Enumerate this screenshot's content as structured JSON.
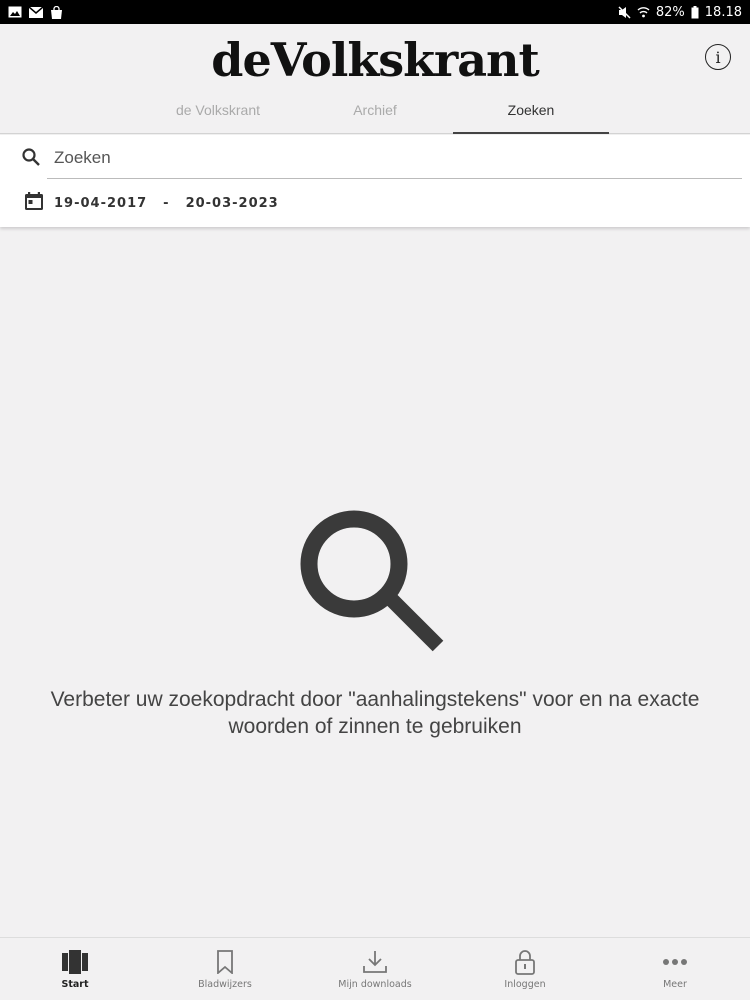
{
  "status_bar": {
    "battery": "82%",
    "time": "18.18",
    "left_icons": [
      "image-icon",
      "mail-icon",
      "shopping-bag-icon"
    ],
    "right_icons": [
      "mute-icon",
      "wifi-icon",
      "battery-icon"
    ]
  },
  "header": {
    "logo": "deVolkskrant",
    "info_icon": "info-icon"
  },
  "tabs": [
    {
      "label": "de Volkskrant"
    },
    {
      "label": "Archief"
    },
    {
      "label": "Zoeken"
    }
  ],
  "search": {
    "placeholder": "Zoeken",
    "value": "",
    "date_from": "19-04-2017",
    "date_separator": "-",
    "date_to": "20-03-2023",
    "icons": [
      "search-icon",
      "calendar-icon"
    ]
  },
  "empty_state": {
    "icon": "magnifier-icon",
    "message": "Verbeter uw zoekopdracht door \"aanhalingstekens\" voor en na exacte woorden of zinnen te gebruiken"
  },
  "bottom_nav": [
    {
      "label": "Start",
      "icon": "newspaper-icon",
      "active": true
    },
    {
      "label": "Bladwijzers",
      "icon": "bookmark-icon",
      "active": false
    },
    {
      "label": "Mijn downloads",
      "icon": "download-icon",
      "active": false
    },
    {
      "label": "Inloggen",
      "icon": "lock-icon",
      "active": false
    },
    {
      "label": "Meer",
      "icon": "more-icon",
      "active": false
    }
  ],
  "colors": {
    "background": "#f2f1f2",
    "active_tab_indicator": "#444444",
    "text_dark": "#333333"
  }
}
